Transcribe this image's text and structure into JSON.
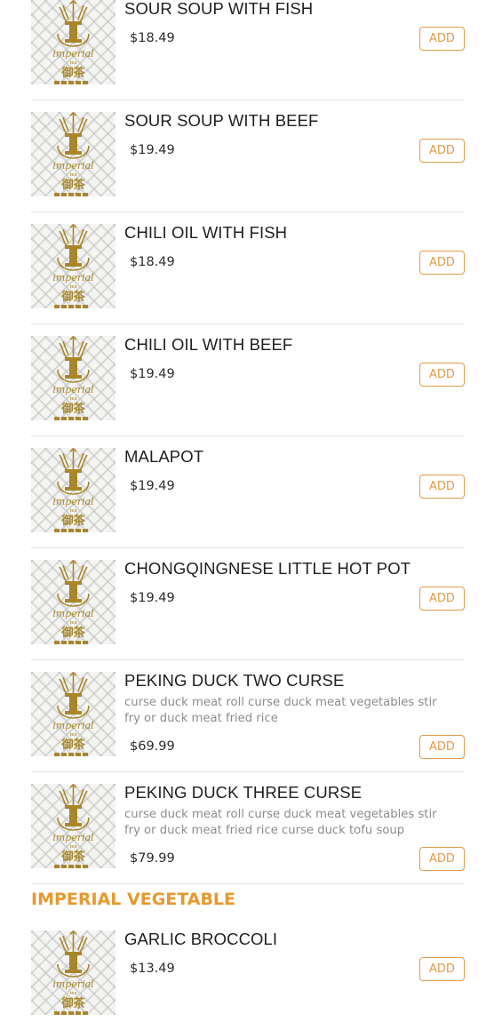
{
  "colors": {
    "accent": "#e39a4a",
    "section": "#e6992f",
    "logo_gold": "#a8862c"
  },
  "logo": {
    "script_text": "imperial",
    "sub_text": "tea",
    "chinese_text": "御茶"
  },
  "add_label": "ADD",
  "items_before": [
    {
      "name": "SOUR SOUP WITH FISH",
      "price": "$18.49",
      "desc": ""
    },
    {
      "name": "SOUR SOUP WITH BEEF",
      "price": "$19.49",
      "desc": ""
    },
    {
      "name": "CHILI OIL WITH FISH",
      "price": "$18.49",
      "desc": ""
    },
    {
      "name": "CHILI OIL WITH BEEF",
      "price": "$19.49",
      "desc": ""
    },
    {
      "name": "MALAPOT",
      "price": "$19.49",
      "desc": ""
    },
    {
      "name": "CHONGQINGNESE LITTLE HOT POT",
      "price": "$19.49",
      "desc": ""
    },
    {
      "name": "PEKING DUCK TWO CURSE",
      "price": "$69.99",
      "desc": "curse duck meat roll curse duck meat vegetables stir fry or duck meat fried rice"
    },
    {
      "name": "PEKING DUCK THREE CURSE",
      "price": "$79.99",
      "desc": "curse duck meat roll curse duck meat vegetables stir fry or duck meat fried rice curse duck tofu soup"
    }
  ],
  "section": {
    "title": "IMPERIAL VEGETABLE"
  },
  "items_after": [
    {
      "name": "GARLIC BROCCOLI",
      "price": "$13.49",
      "desc": ""
    }
  ]
}
